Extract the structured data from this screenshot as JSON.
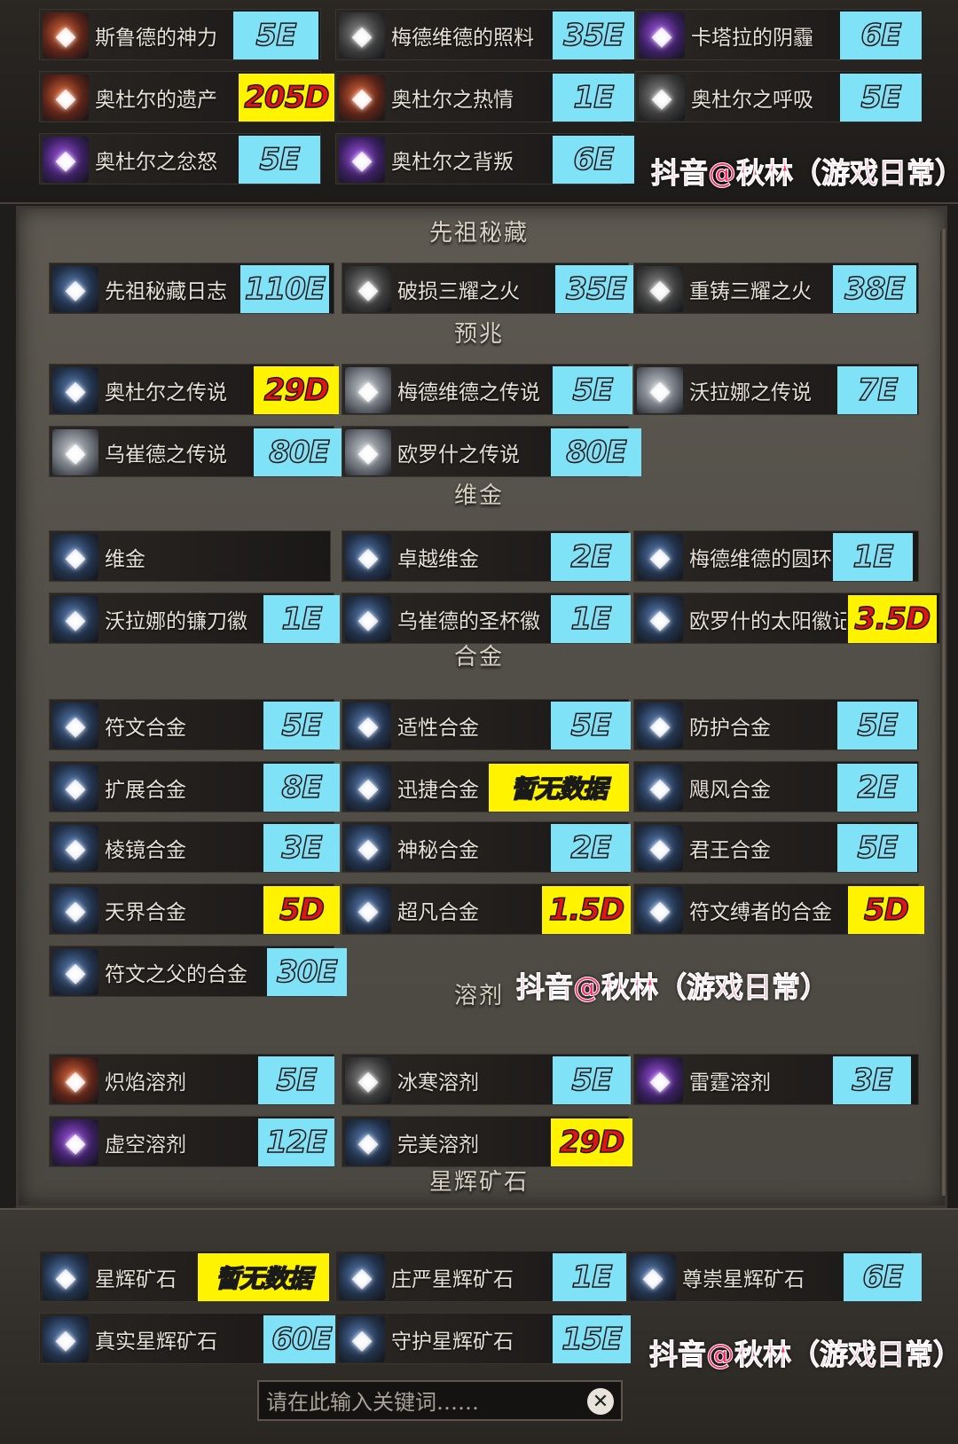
{
  "headings": {
    "ancestral": "先祖秘藏",
    "omens": "预兆",
    "vijin": "维金",
    "alloys": "合金",
    "solvents": "溶剂",
    "starstone_a": "星辉矿石",
    "starstone_b": "星辉矿石"
  },
  "items": [
    {
      "name": "斯鲁德的神力",
      "price": "5E"
    },
    {
      "name": "梅德维德的照料",
      "price": "35E"
    },
    {
      "name": "卡塔拉的阴霾",
      "price": "6E"
    },
    {
      "name": "奥杜尔的遗产",
      "price": "205D"
    },
    {
      "name": "奥杜尔之热情",
      "price": "1E"
    },
    {
      "name": "奥杜尔之呼吸",
      "price": "5E"
    },
    {
      "name": "奥杜尔之忿怒",
      "price": "5E"
    },
    {
      "name": "奥杜尔之背叛",
      "price": "6E"
    },
    {
      "name": "先祖秘藏日志",
      "price": "110E"
    },
    {
      "name": "破损三耀之火",
      "price": "35E"
    },
    {
      "name": "重铸三耀之火",
      "price": "38E"
    },
    {
      "name": "奥杜尔之传说",
      "price": "29D"
    },
    {
      "name": "梅德维德之传说",
      "price": "5E"
    },
    {
      "name": "沃拉娜之传说",
      "price": "7E"
    },
    {
      "name": "乌崔德之传说",
      "price": "80E"
    },
    {
      "name": "欧罗什之传说",
      "price": "80E"
    },
    {
      "name": "维金",
      "price": ""
    },
    {
      "name": "卓越维金",
      "price": "2E"
    },
    {
      "name": "梅德维德的圆环",
      "price": "1E"
    },
    {
      "name": "沃拉娜的镰刀徽",
      "price": "1E"
    },
    {
      "name": "乌崔德的圣杯徽",
      "price": "1E"
    },
    {
      "name": "欧罗什的太阳徽记",
      "price": "3.5D"
    },
    {
      "name": "符文合金",
      "price": "5E"
    },
    {
      "name": "适性合金",
      "price": "5E"
    },
    {
      "name": "防护合金",
      "price": "5E"
    },
    {
      "name": "扩展合金",
      "price": "8E"
    },
    {
      "name": "迅捷合金",
      "price": "暂无数据"
    },
    {
      "name": "飓风合金",
      "price": "2E"
    },
    {
      "name": "棱镜合金",
      "price": "3E"
    },
    {
      "name": "神秘合金",
      "price": "2E"
    },
    {
      "name": "君王合金",
      "price": "5E"
    },
    {
      "name": "天界合金",
      "price": "5D"
    },
    {
      "name": "超凡合金",
      "price": "1.5D"
    },
    {
      "name": "符文缚者的合金",
      "price": "5D"
    },
    {
      "name": "符文之父的合金",
      "price": "30E"
    },
    {
      "name": "炽焰溶剂",
      "price": "5E"
    },
    {
      "name": "冰寒溶剂",
      "price": "5E"
    },
    {
      "name": "雷霆溶剂",
      "price": "3E"
    },
    {
      "name": "虚空溶剂",
      "price": "12E"
    },
    {
      "name": "完美溶剂",
      "price": "29D"
    },
    {
      "name": "星辉矿石",
      "price": "暂无数据"
    },
    {
      "name": "庄严星辉矿石",
      "price": "1E"
    },
    {
      "name": "尊崇星辉矿石",
      "price": "6E"
    },
    {
      "name": "真实星辉矿石",
      "price": "60E"
    },
    {
      "name": "守护星辉矿石",
      "price": "15E"
    }
  ],
  "watermark": "抖音@秋林（游戏日常）",
  "search": {
    "placeholder": "请在此输入关键词……"
  },
  "icons": {
    "clear": "close-circle-icon"
  },
  "colors": {
    "price_blue": "#7fe2f6",
    "price_yellow": "#fff300",
    "price_red_text": "#e01414",
    "watermark": "#ff2f6a"
  }
}
